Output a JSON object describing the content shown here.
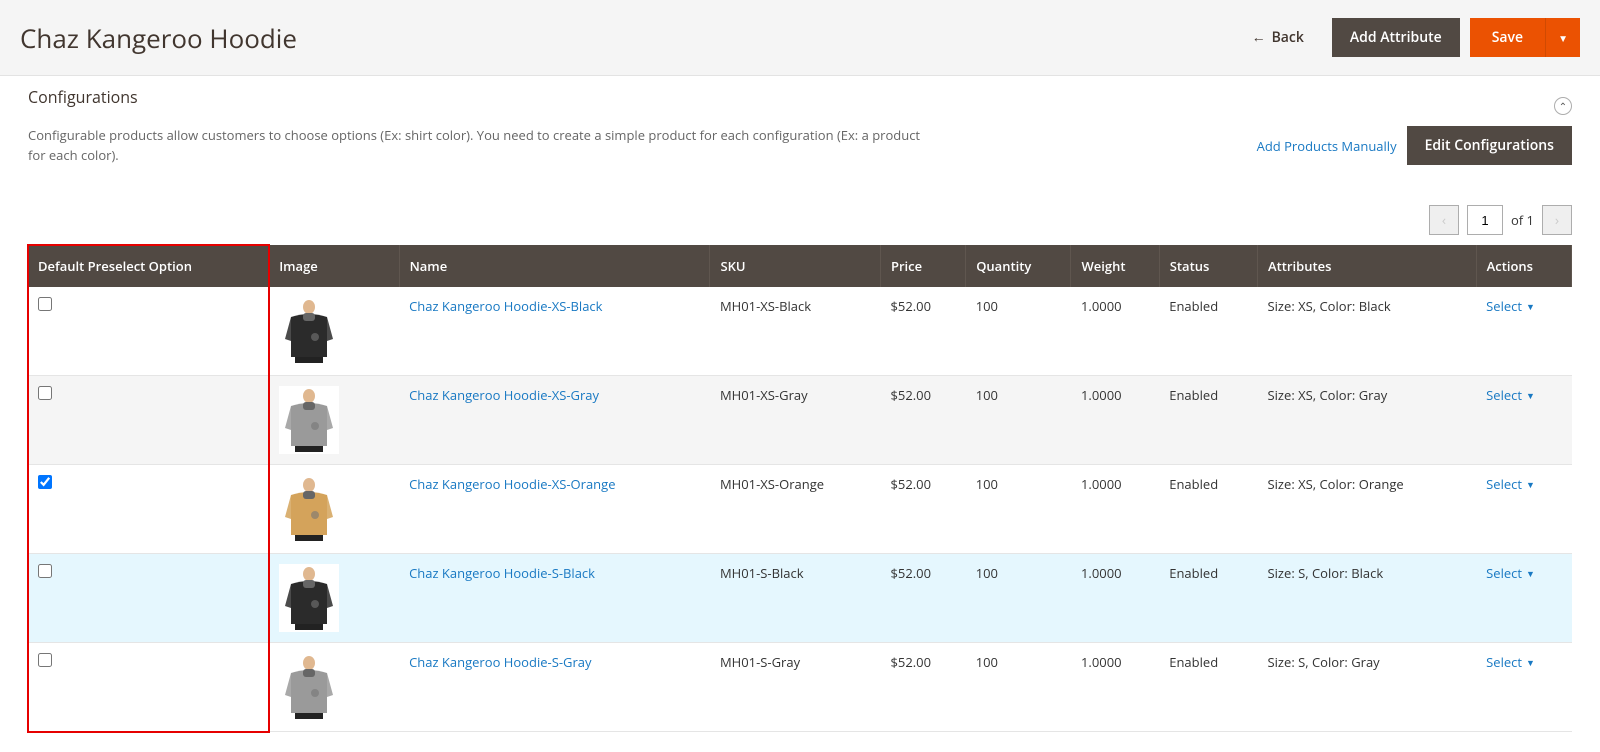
{
  "header": {
    "title": "Chaz Kangeroo Hoodie",
    "back_label": "Back",
    "add_attribute_label": "Add Attribute",
    "save_label": "Save"
  },
  "section": {
    "title": "Configurations",
    "description": "Configurable products allow customers to choose options (Ex: shirt color). You need to create a simple product for each configuration (Ex: a product for each color).",
    "add_manually_label": "Add Products Manually",
    "edit_config_label": "Edit Configurations"
  },
  "pager": {
    "page": "1",
    "of_label": "of 1"
  },
  "columns": {
    "preselect": "Default Preselect Option",
    "image": "Image",
    "name": "Name",
    "sku": "SKU",
    "price": "Price",
    "quantity": "Quantity",
    "weight": "Weight",
    "status": "Status",
    "attributes": "Attributes",
    "actions": "Actions"
  },
  "action_select_label": "Select",
  "rows": [
    {
      "checked": false,
      "hoodie_color": "#2b2b2b",
      "name": "Chaz Kangeroo Hoodie-XS-Black",
      "sku": "MH01-XS-Black",
      "price": "$52.00",
      "qty": "100",
      "weight": "1.0000",
      "status": "Enabled",
      "attributes": "Size: XS, Color: Black",
      "row_class": "odd"
    },
    {
      "checked": false,
      "hoodie_color": "#9a9a9a",
      "name": "Chaz Kangeroo Hoodie-XS-Gray",
      "sku": "MH01-XS-Gray",
      "price": "$52.00",
      "qty": "100",
      "weight": "1.0000",
      "status": "Enabled",
      "attributes": "Size: XS, Color: Gray",
      "row_class": "even"
    },
    {
      "checked": true,
      "hoodie_color": "#d4a35b",
      "name": "Chaz Kangeroo Hoodie-XS-Orange",
      "sku": "MH01-XS-Orange",
      "price": "$52.00",
      "qty": "100",
      "weight": "1.0000",
      "status": "Enabled",
      "attributes": "Size: XS, Color: Orange",
      "row_class": "odd"
    },
    {
      "checked": false,
      "hoodie_color": "#2b2b2b",
      "name": "Chaz Kangeroo Hoodie-S-Black",
      "sku": "MH01-S-Black",
      "price": "$52.00",
      "qty": "100",
      "weight": "1.0000",
      "status": "Enabled",
      "attributes": "Size: S, Color: Black",
      "row_class": "hover"
    },
    {
      "checked": false,
      "hoodie_color": "#9a9a9a",
      "name": "Chaz Kangeroo Hoodie-S-Gray",
      "sku": "MH01-S-Gray",
      "price": "$52.00",
      "qty": "100",
      "weight": "1.0000",
      "status": "Enabled",
      "attributes": "Size: S, Color: Gray",
      "row_class": "odd"
    }
  ]
}
